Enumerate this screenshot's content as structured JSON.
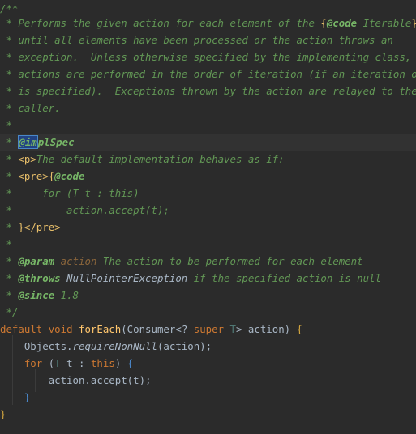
{
  "code": {
    "l1": "/**",
    "l2_a": " * Performs the given action for each element of the ",
    "l2_b": "{",
    "l2_c": "@code",
    "l2_d": " Iterable",
    "l2_e": "}",
    "l3": " * until all elements have been processed or the action throws an",
    "l4": " * exception.  Unless otherwise specified by the implementing class,",
    "l5": " * actions are performed in the order of iteration (if an iteration orde",
    "l6": " * is specified).  Exceptions thrown by the action are relayed to the",
    "l7": " * caller.",
    "l8": " *",
    "l9_a": " * ",
    "l9_b": "@im",
    "l9_c": "plSpec",
    "l10_a": " * ",
    "l10_b": "<p>",
    "l10_c": "The default implementation behaves as if:",
    "l11_a": " * ",
    "l11_b": "<pre>",
    "l11_c": "{",
    "l11_d": "@code",
    "l12": " *     for (T t : this)",
    "l13": " *         action.accept(t);",
    "l14_a": " * ",
    "l14_b": "}",
    "l14_c": "</pre>",
    "l15": " *",
    "l16_a": " * ",
    "l16_b": "@param",
    "l16_c": " action",
    "l16_d": " The action to be performed for each element",
    "l17_a": " * ",
    "l17_b": "@throws",
    "l17_c": " NullPointerException",
    "l17_d": " if the specified action is null",
    "l18_a": " * ",
    "l18_b": "@since",
    "l18_c": " 1.8",
    "l19": " */",
    "l20_kw1": "default",
    "l20_kw2": "void",
    "l20_fn": "forEach",
    "l20_p1": "(Consumer<? ",
    "l20_kw3": "super",
    "l20_tp": "T",
    "l20_p2": "> action) ",
    "l20_br": "{",
    "l21_a": "    Objects.",
    "l21_b": "requireNonNull",
    "l21_c": "(action);",
    "l22_kw": "for",
    "l22_p1": " (",
    "l22_tp": "T",
    "l22_p2": " t : ",
    "l22_kw2": "this",
    "l22_p3": ") ",
    "l22_br": "{",
    "l23": "        action.accept(t);",
    "l24": "}",
    "l25": "}"
  }
}
